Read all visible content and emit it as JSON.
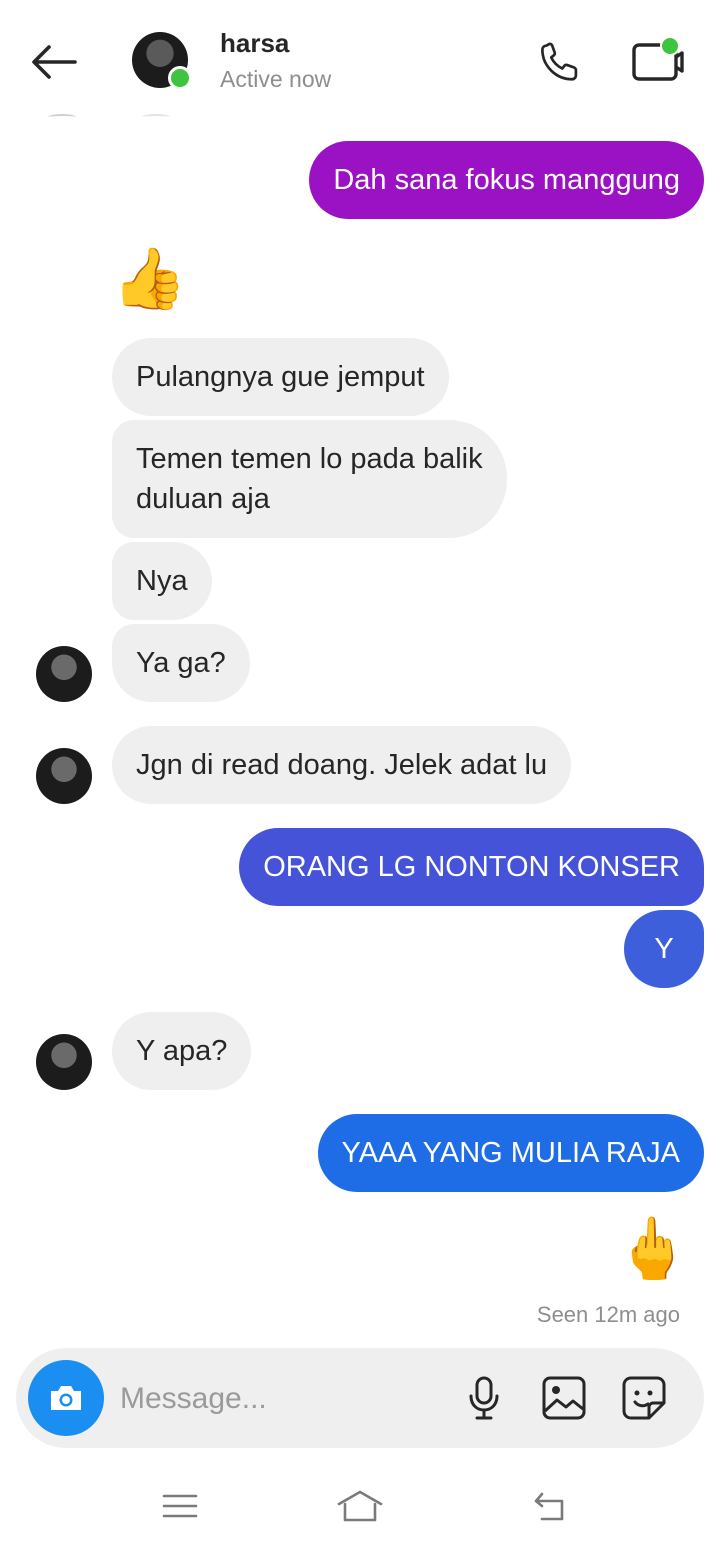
{
  "header": {
    "contact_name": "harsa",
    "status": "Active now",
    "icons": {
      "back": "back-arrow-icon",
      "call": "phone-icon",
      "video": "video-call-icon"
    }
  },
  "messages": [
    {
      "side": "out",
      "text": "Dah sana fokus manggung",
      "color": "#9a12c4"
    },
    {
      "side": "in",
      "emoji": "👍"
    },
    {
      "side": "in",
      "text": "Pulangnya gue jemput"
    },
    {
      "side": "in",
      "text": "Temen temen lo pada balik\nduluan aja"
    },
    {
      "side": "in",
      "text": "Nya"
    },
    {
      "side": "in",
      "text": "Ya ga?"
    },
    {
      "side": "in",
      "text": "Jgn di read doang. Jelek adat lu"
    },
    {
      "side": "out",
      "text": "ORANG LG NONTON KONSER",
      "color": "#4553d8"
    },
    {
      "side": "out",
      "text": "Y",
      "color": "#3d5fdc"
    },
    {
      "side": "in",
      "text": "Y apa?"
    },
    {
      "side": "out",
      "text": "YAAA YANG MULIA RAJA",
      "color": "#1f6de6"
    },
    {
      "side": "out",
      "emoji": "🖕"
    }
  ],
  "seen_text": "Seen 12m ago",
  "composer": {
    "placeholder": "Message...",
    "icons": [
      "camera-icon",
      "microphone-icon",
      "gallery-icon",
      "sticker-icon"
    ]
  },
  "colors": {
    "online": "#3ec43e",
    "camera_button": "#1b8ef2",
    "incoming_bubble": "#efefef"
  }
}
